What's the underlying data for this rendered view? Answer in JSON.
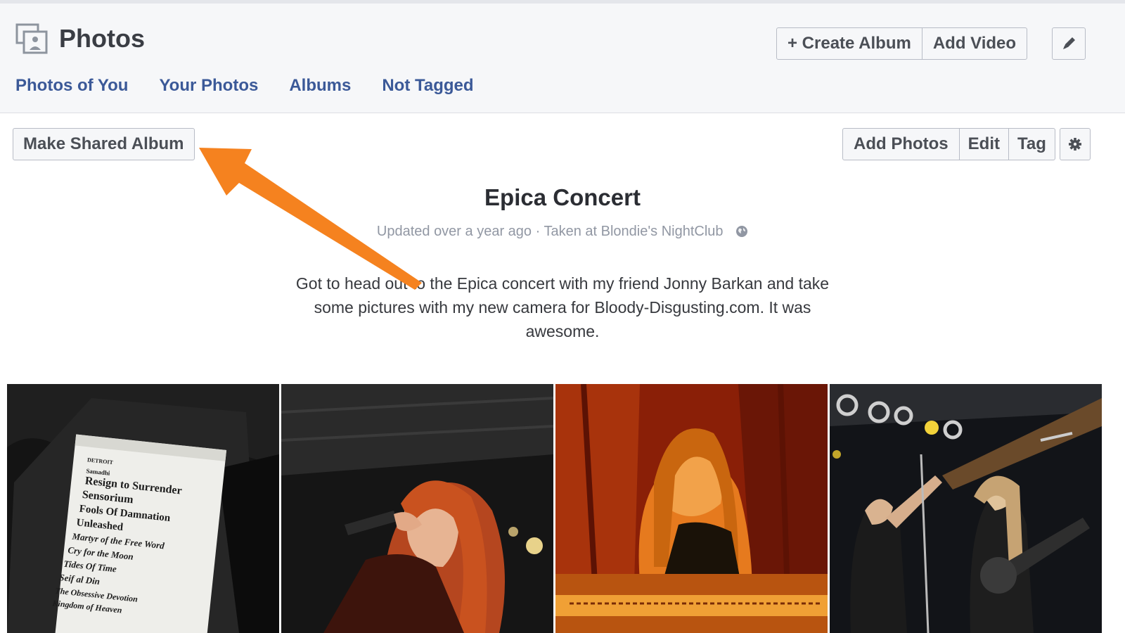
{
  "header": {
    "title": "Photos",
    "create_album_label": "+ Create Album",
    "add_video_label": "Add Video",
    "edit_icon": "pencil-icon"
  },
  "tabs": [
    {
      "label": "Photos of You"
    },
    {
      "label": "Your Photos"
    },
    {
      "label": "Albums"
    },
    {
      "label": "Not Tagged"
    }
  ],
  "toolbar": {
    "make_shared_album_label": "Make Shared Album",
    "add_photos_label": "Add Photos",
    "edit_label": "Edit",
    "tag_label": "Tag",
    "settings_icon": "gear-icon"
  },
  "album": {
    "title": "Epica Concert",
    "meta": "Updated over a year ago · Taken at Blondie's NightClub",
    "privacy_icon": "globe-icon",
    "description": "Got to head out to the Epica concert with my friend Jonny Barkan and take some pictures with my new camera for Bloody-Disgusting.com. It was awesome."
  },
  "setlist": {
    "heading": "DETROIT",
    "opener": "Samadhi",
    "songs": [
      "Resign to Surrender",
      "Sensorium",
      "Fools Of Damnation",
      "Unleashed",
      "Martyr of the Free Word",
      "Cry for the Moon",
      "Tides Of Time",
      "Seif al Din",
      "The Obsessive Devotion",
      "Kingdom of Heaven"
    ]
  },
  "colors": {
    "link_blue": "#3b5998",
    "arrow_orange": "#f5821f",
    "header_bg": "#f6f7f9"
  }
}
